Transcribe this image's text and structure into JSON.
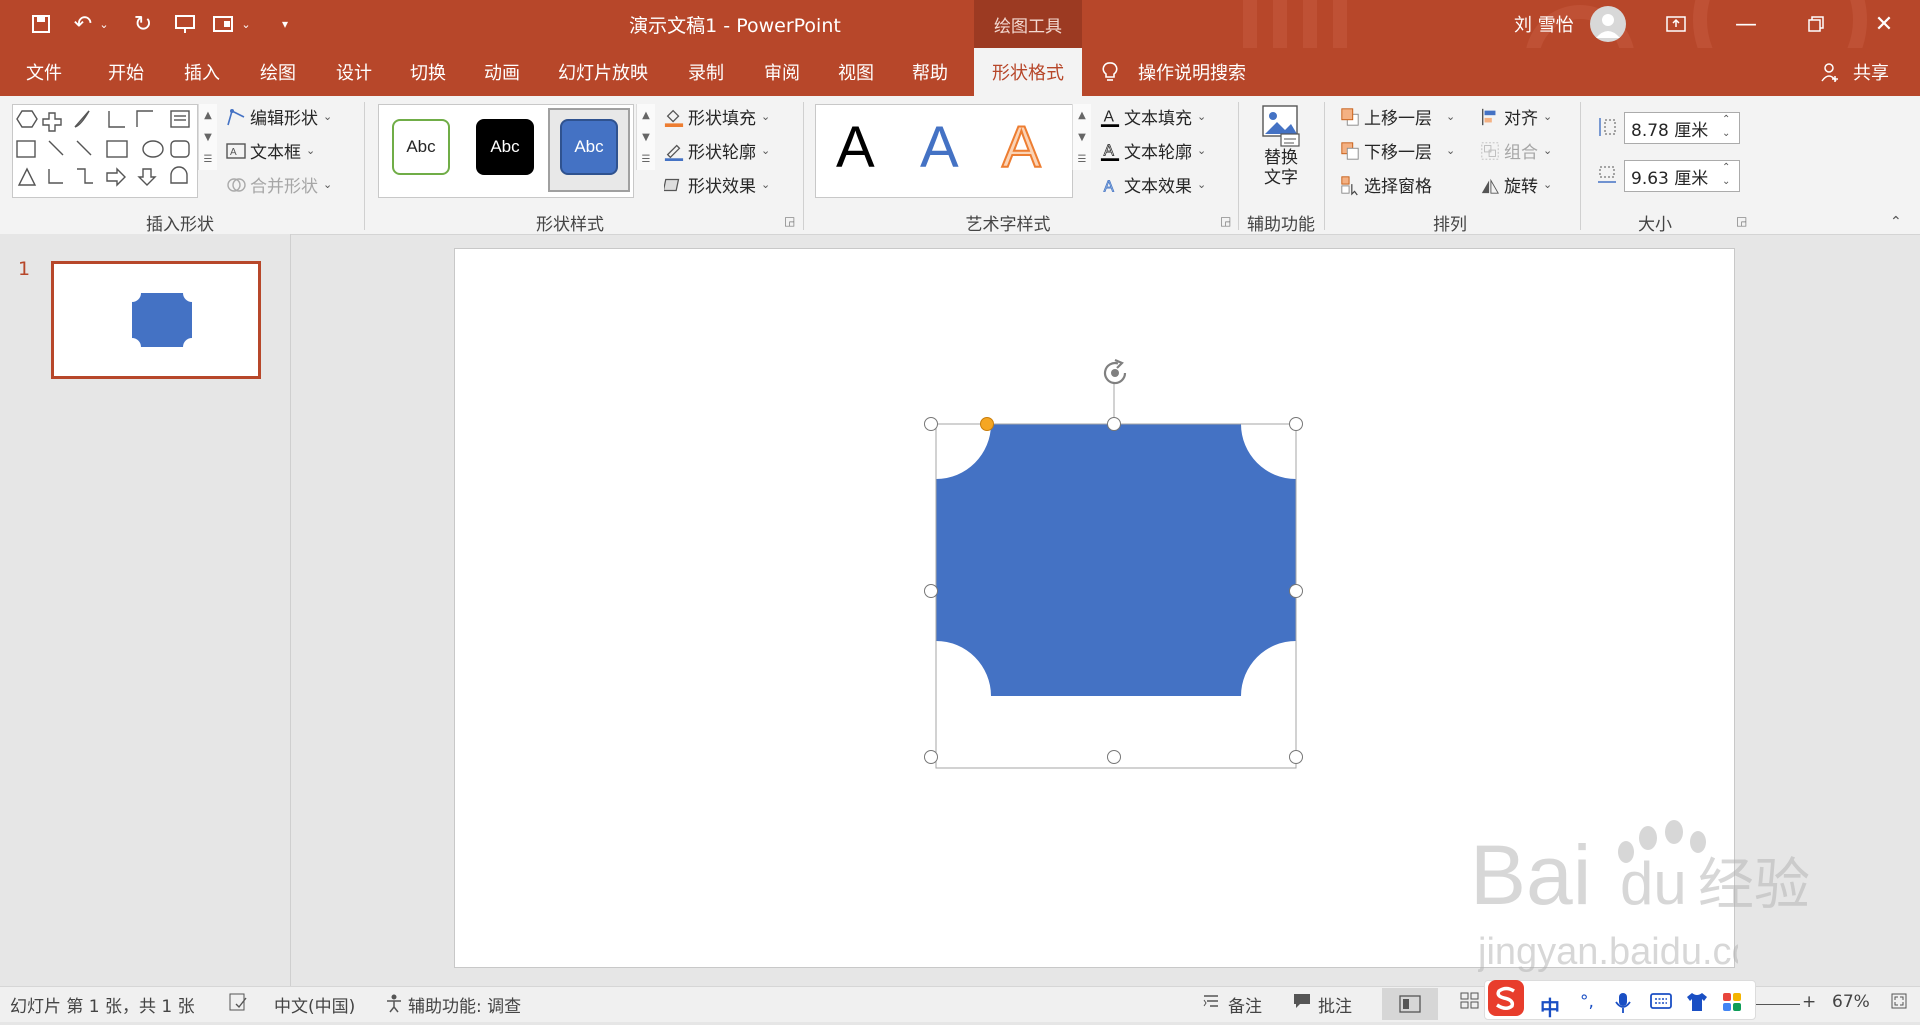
{
  "colors": {
    "accent": "#b7472a",
    "shape_fill": "#4472c4",
    "tab_bg": "#f3f3f3"
  },
  "title_bar": {
    "document_title": "演示文稿1  -  PowerPoint",
    "context_tab": "绘图工具",
    "user_name": "刘 雪怡",
    "qat_icons": [
      "save-icon",
      "undo-icon",
      "redo-icon",
      "present-icon",
      "layout-icon",
      "customize-icon"
    ]
  },
  "tabs": [
    {
      "label": "文件"
    },
    {
      "label": "开始"
    },
    {
      "label": "插入"
    },
    {
      "label": "绘图"
    },
    {
      "label": "设计"
    },
    {
      "label": "切换"
    },
    {
      "label": "动画"
    },
    {
      "label": "幻灯片放映"
    },
    {
      "label": "录制"
    },
    {
      "label": "审阅"
    },
    {
      "label": "视图"
    },
    {
      "label": "帮助"
    },
    {
      "label": "形状格式"
    }
  ],
  "tell_me": "操作说明搜索",
  "share": "共享",
  "ribbon": {
    "insert_shapes": {
      "label": "插入形状",
      "edit_shape": "编辑形状",
      "text_box": "文本框",
      "merge_shapes": "合并形状"
    },
    "shape_styles": {
      "label": "形状样式",
      "samples": [
        "Abc",
        "Abc",
        "Abc"
      ],
      "fill": "形状填充",
      "outline": "形状轮廓",
      "effects": "形状效果"
    },
    "wordart_styles": {
      "label": "艺术字样式",
      "letters": [
        "A",
        "A",
        "A"
      ],
      "text_fill": "文本填充",
      "text_outline": "文本轮廓",
      "text_effects": "文本效果"
    },
    "accessibility": {
      "label": "辅助功能",
      "alt_text_line1": "替换",
      "alt_text_line2": "文字"
    },
    "arrange": {
      "label": "排列",
      "bring_forward": "上移一层",
      "send_backward": "下移一层",
      "selection_pane": "选择窗格",
      "align": "对齐",
      "group": "组合",
      "rotate": "旋转"
    },
    "size": {
      "label": "大小",
      "height": "8.78 厘米",
      "width": "9.63 厘米"
    }
  },
  "thumbnails": [
    {
      "number": "1"
    }
  ],
  "status": {
    "slide_info": "幻灯片 第 1 张，共 1 张",
    "language": "中文(中国)",
    "accessibility": "辅助功能: 调查",
    "notes": "备注",
    "comments": "批注",
    "zoom": "67%"
  },
  "ime": {
    "chars": [
      "中",
      "°,"
    ]
  },
  "watermark": {
    "brand": "Bai  du 经验",
    "url": "jingyan.baidu.com"
  }
}
